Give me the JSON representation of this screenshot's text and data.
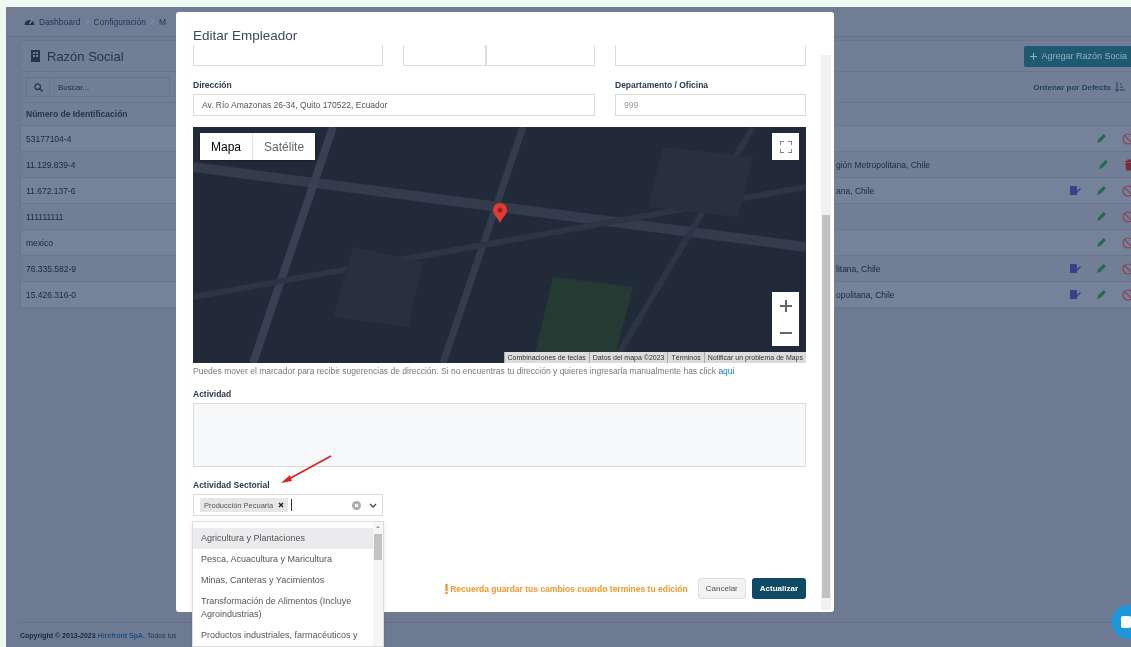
{
  "background": {
    "breadcrumb": [
      {
        "label": "Dashboard"
      },
      {
        "label": "Configuración"
      },
      {
        "label": "M"
      }
    ],
    "card_title": "Razón Social",
    "add_button": "Agregar Razón Socia",
    "search": {
      "placeholder": "Buscar..."
    },
    "sort_label": "Ordenar por Defecto",
    "columns": [
      "Número de Identificación"
    ],
    "rows": [
      {
        "id": "53177104-4",
        "actions": [
          {
            "kind": "edit"
          },
          {
            "kind": "block"
          }
        ]
      },
      {
        "id": "11.129.839-4",
        "column_2": "gión Metropolitana, Chile",
        "actions": [
          {
            "kind": "edit"
          },
          {
            "kind": "delete"
          }
        ]
      },
      {
        "id": "11.672.137-6",
        "column_2": "ana, Chile",
        "actions": [
          {
            "kind": "document"
          },
          {
            "kind": "edit"
          },
          {
            "kind": "block"
          }
        ]
      },
      {
        "id": "111111111",
        "actions": [
          {
            "kind": "edit"
          },
          {
            "kind": "block"
          }
        ]
      },
      {
        "id": "mexico",
        "actions": [
          {
            "kind": "edit"
          },
          {
            "kind": "block"
          }
        ]
      },
      {
        "id": "76.335.582-9",
        "column_2": "litana, Chile",
        "actions": [
          {
            "kind": "document"
          },
          {
            "kind": "edit"
          },
          {
            "kind": "block"
          }
        ]
      },
      {
        "id": "15.426.316-0",
        "column_2": "opolitana, Chile",
        "actions": [
          {
            "kind": "document"
          },
          {
            "kind": "edit"
          },
          {
            "kind": "block"
          }
        ]
      }
    ],
    "footer": {
      "copyright": "Copyright © 2013-2023",
      "company": "Hirefront SpA.",
      "rights": "Todos los"
    }
  },
  "modal": {
    "title": "Editar Empleador",
    "address": {
      "label": "Dirección",
      "value": "Av. Río Amazonas 26-34, Quito 170522, Ecuador"
    },
    "office": {
      "label": "Departamento / Oficina",
      "placeholder": "999"
    },
    "map": {
      "picture": {
        "kind": "picture"
      },
      "tabs": [
        {
          "label": "Mapa",
          "selected": true
        },
        {
          "label": "Satélite",
          "selected": false
        }
      ],
      "attribution": [
        "Combinaciones de teclas",
        "Datos del mapa ©2023",
        "Términos",
        "Notificar un problema de Maps"
      ]
    },
    "hint": "Puedes mover el marcador para recibir sugerencias de dirección. Si no encuentras tu dirección y quieres ingresarla manualmente has click",
    "hint_link": "aqui",
    "activity": {
      "label": "Actividad"
    },
    "sector": {
      "label": "Actividad Sectorial",
      "tags": [
        {
          "label": "Producción Pecuaria"
        }
      ],
      "options": [
        {
          "label": "Agricultura y Plantaciones",
          "selected": true
        },
        {
          "label": "Pesca, Acuacultura y Maricultura",
          "selected": false
        },
        {
          "label": "Minas, Canteras y Yacimientos",
          "selected": false
        },
        {
          "label": "Transformación de Alimentos (Incluye Agroindustrias)",
          "selected": false
        },
        {
          "label": "Productos industriales, farmacéuticos y",
          "selected": false
        }
      ]
    },
    "warning": "Recuerda guardar tus cambios cuando termines tu edición",
    "buttons": [
      {
        "label": "Cancelar",
        "kind": "secondary"
      },
      {
        "label": "Actualizar",
        "kind": "primary"
      }
    ]
  }
}
